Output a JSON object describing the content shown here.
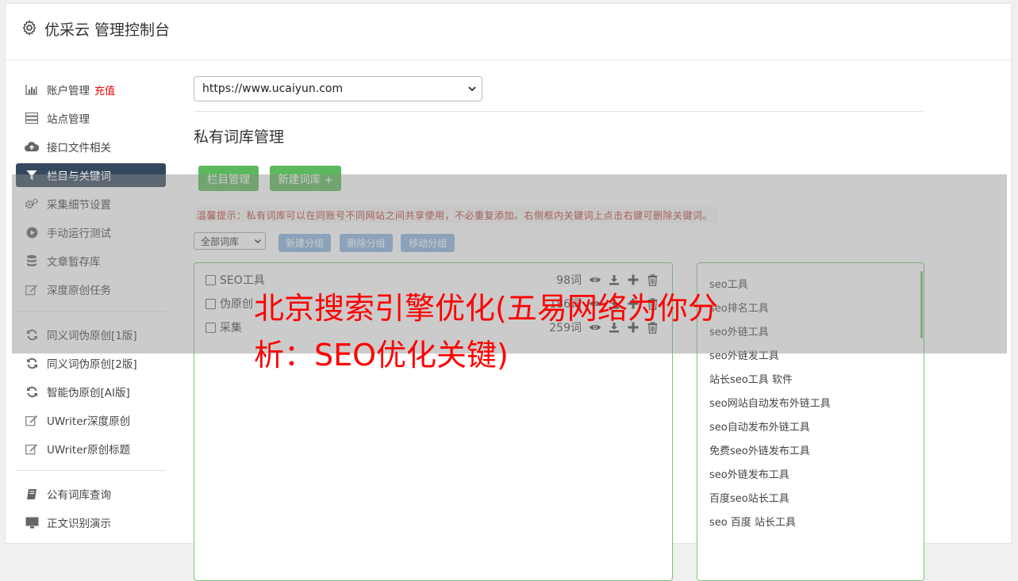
{
  "header": {
    "title": "优采云 管理控制台",
    "icon": "gear-icon"
  },
  "sidebar": {
    "items": [
      {
        "label": "账户管理",
        "badge": "充值",
        "icon": "bar-chart-icon"
      },
      {
        "label": "站点管理",
        "icon": "server-icon"
      },
      {
        "label": "接口文件相关",
        "icon": "cloud-upload-icon"
      },
      {
        "label": "栏目与关键词",
        "icon": "filter-icon",
        "active": true
      },
      {
        "label": "采集细节设置",
        "icon": "cogs-icon"
      },
      {
        "label": "手动运行测试",
        "icon": "play-circle-icon"
      },
      {
        "label": "文章暂存库",
        "icon": "database-icon"
      },
      {
        "label": "深度原创任务",
        "icon": "edit-icon"
      },
      {
        "label": "同义词伪原创[1版]",
        "icon": "refresh-icon"
      },
      {
        "label": "同义词伪原创[2版]",
        "icon": "refresh-icon"
      },
      {
        "label": "智能伪原创[AI版]",
        "icon": "refresh-icon"
      },
      {
        "label": "UWriter深度原创",
        "icon": "edit-icon"
      },
      {
        "label": "UWriter原创标题",
        "icon": "edit-icon"
      },
      {
        "label": "公有词库查询",
        "icon": "book-icon"
      },
      {
        "label": "正文识别演示",
        "icon": "monitor-icon"
      }
    ]
  },
  "main": {
    "site_select": "https://www.ucaiyun.com",
    "section_title": "私有词库管理",
    "btn_columns": "栏目管理",
    "btn_new_lib": "新建词库 +",
    "tip": "温馨提示：私有词库可以在同账号不同网站之间共享使用，不必重复添加。右侧框内关键词上点击右键可删除关键词。",
    "group_select": "全部词库",
    "btn_new_group": "新建分组",
    "btn_delete_group": "删除分组",
    "btn_move_group": "移动分组",
    "libraries": [
      {
        "name": "SEO工具",
        "count": "98词"
      },
      {
        "name": "伪原创",
        "count": "186词"
      },
      {
        "name": "采集",
        "count": "259词"
      }
    ],
    "keywords": [
      "seo工具",
      "seo排名工具",
      "seo外链工具",
      "seo外链发工具",
      "站长seo工具 软件",
      "seo网站自动发布外链工具",
      "seo自动发布外链工具",
      "免费seo外链发布工具",
      "seo外链发布工具",
      "百度seo站长工具",
      "seo 百度 站长工具"
    ]
  },
  "overlay_title": "北京搜索引擎优化(五易网络为你分析：SEO优化关键)",
  "colors": {
    "active_nav": "#34495e",
    "green_button": "#5cb85c",
    "blue_button": "#8ab4e0",
    "tip_text": "#c0392b",
    "overlay_text": "#ff0000"
  }
}
